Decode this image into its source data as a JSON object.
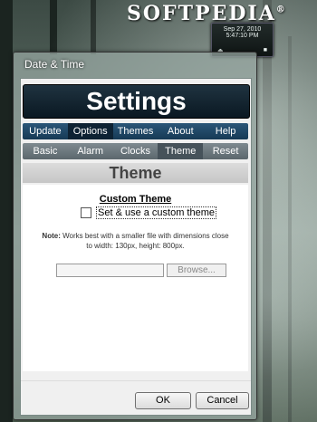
{
  "desktop": {
    "brand": "SOFTPEDIA",
    "brand_mark": "®",
    "clock_date": "Sep 27, 2010",
    "clock_time": "5:47:10 PM"
  },
  "window": {
    "title": "Date & Time",
    "banner": "Settings",
    "menu": [
      {
        "label": "Update"
      },
      {
        "label": "Options"
      },
      {
        "label": "Themes"
      },
      {
        "label": "About"
      },
      {
        "label": "Help"
      }
    ],
    "active_menu": "Options",
    "submenu": [
      {
        "label": "Basic"
      },
      {
        "label": "Alarm"
      },
      {
        "label": "Clocks"
      },
      {
        "label": "Theme"
      },
      {
        "label": "Reset"
      }
    ],
    "active_submenu": "Theme",
    "section_title": "Theme",
    "custom_theme": {
      "heading": "Custom Theme",
      "checkbox_label": "Set & use a custom theme",
      "checked": false,
      "note_bold": "Note:",
      "note_text": " Works best with a smaller file with dimensions close to width: 130px, height: 800px.",
      "file_value": "",
      "browse_label": "Browse..."
    },
    "buttons": {
      "ok": "OK",
      "cancel": "Cancel"
    }
  }
}
